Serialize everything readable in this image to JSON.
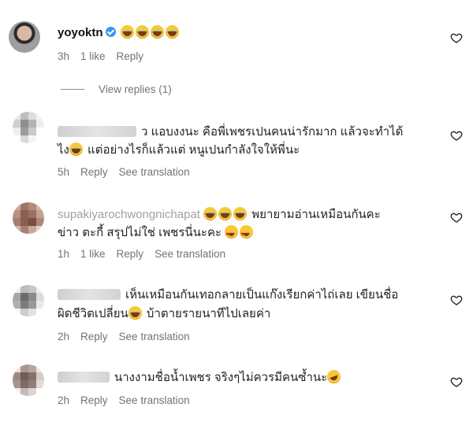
{
  "main_comment": {
    "username": "yoyoktn",
    "emojis": [
      "lol",
      "lol",
      "lol",
      "lol"
    ],
    "time": "3h",
    "likes": "1 like",
    "reply": "Reply"
  },
  "view_replies": "View replies (1)",
  "comments": [
    {
      "line1": "ว แอบงงนะ คือพี่เพชรเปนคนน่ารักมาก แล้วจะทำได้",
      "line2_pre": "ไง",
      "line2_post": " แต่อย่างไรก็แล้วแต่ หนูเปนกำลังใจให้พี่นะ",
      "time": "5h",
      "reply": "Reply",
      "see_translation": "See translation"
    },
    {
      "username_partial": "supakiyarochwongnichapat",
      "line1_post": " พยายามอ่านเหมือนกันคะ",
      "line2": "ข่าว ตะกี้ สรุปไม่ใช่ เพชรนี่นะคะ ",
      "time": "1h",
      "likes": "1 like",
      "reply": "Reply",
      "see_translation": "See translation"
    },
    {
      "line1": "เห็นเหมือนกันเทอกลายเป็นแก๊งเรียกค่าไถ่เลย เขียนชื่อ",
      "line2_pre": "ผิดชีวิตเปลี่ยน",
      "line2_post": " บ้าตายรายนาทีไปเลยค่า",
      "time": "2h",
      "reply": "Reply",
      "see_translation": "See translation"
    },
    {
      "line1": "นางงามชื่อน้ำเพชร จริงๆไม่ควรมีคนซ้ำนะ",
      "time": "2h",
      "reply": "Reply",
      "see_translation": "See translation"
    }
  ],
  "colors": {
    "meta_text": "#737373",
    "verified_blue": "#3897f0"
  },
  "icons": [
    "heart-outline-icon",
    "verified-badge-icon"
  ]
}
